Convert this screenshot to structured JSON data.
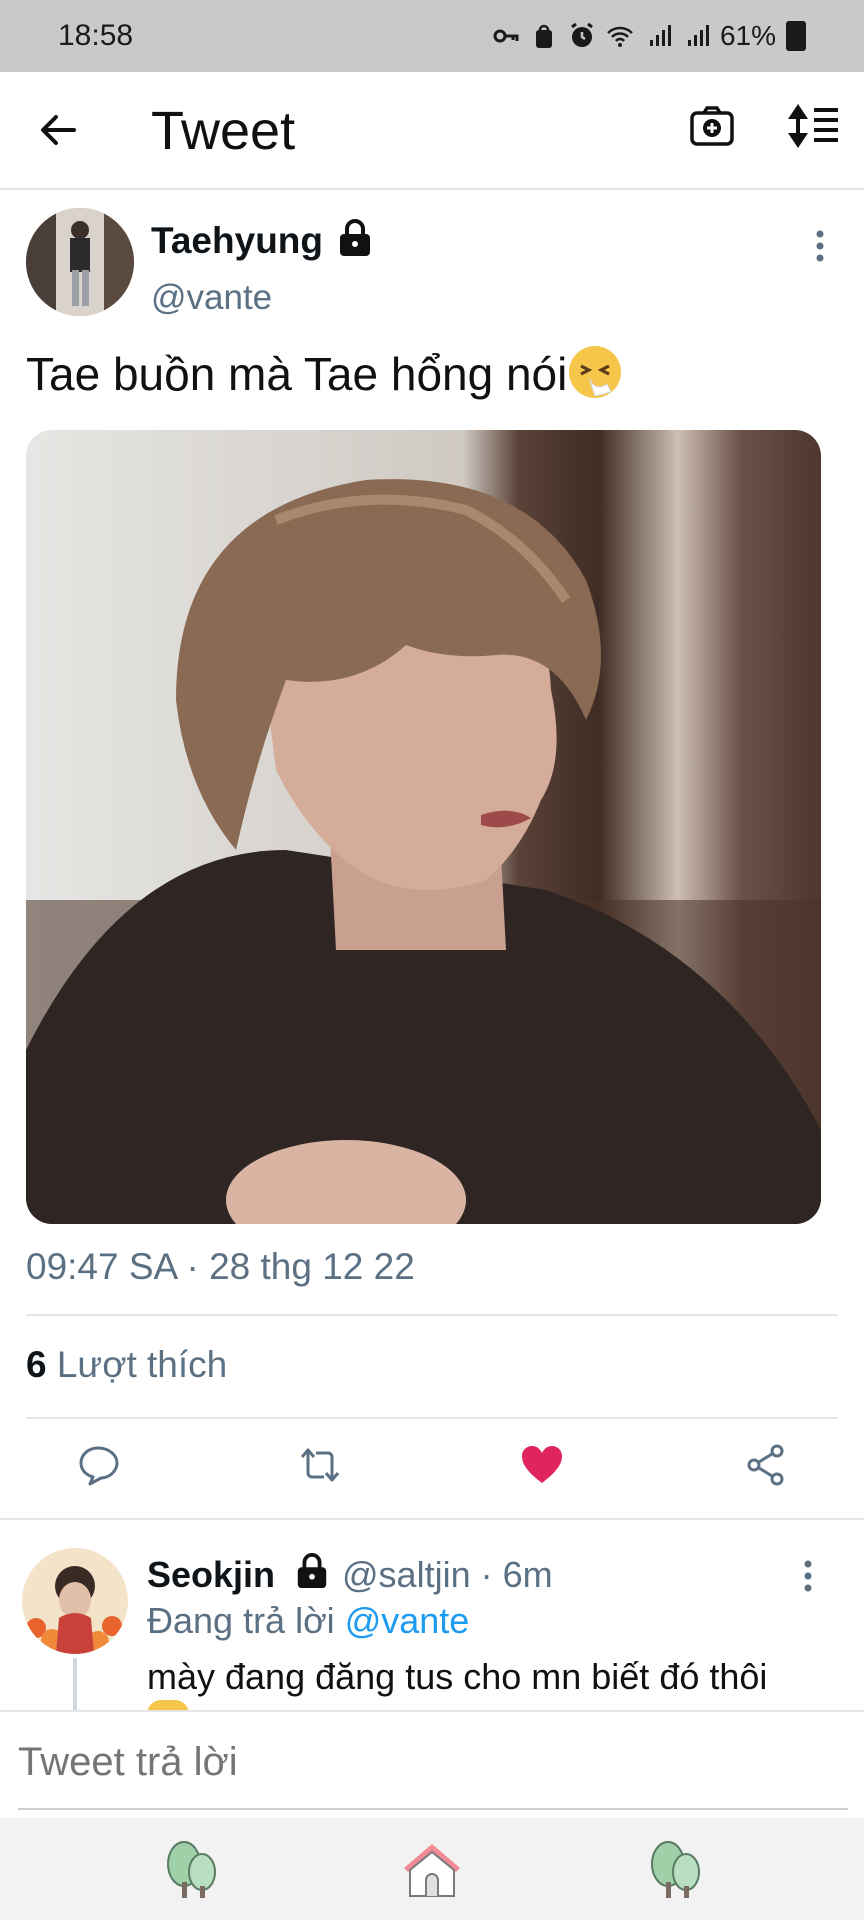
{
  "status_bar": {
    "time": "18:58",
    "battery": "61%",
    "icons": [
      "key-icon",
      "bag-icon",
      "alarm-icon",
      "wifi-icon",
      "signal-icon",
      "signal-icon",
      "battery-icon"
    ]
  },
  "header": {
    "title": "Tweet",
    "icons": [
      "back-arrow-icon",
      "camera-icon",
      "sort-icon"
    ]
  },
  "tweet": {
    "display_name": "Taehyung",
    "handle": "@vante",
    "text": "Tae buồn mà Tae hổng nói",
    "emoji": "sneezing-face",
    "timestamp": "09:47 SA · 28 thg 12 22",
    "likes_count": "6",
    "likes_label": "Lượt thích",
    "liked": true,
    "like_color": "#e0245e"
  },
  "actions": [
    "reply-icon",
    "retweet-icon",
    "like-icon",
    "share-icon"
  ],
  "reply": {
    "display_name": "Seokjin",
    "handle_time": "@saltjin · 6m",
    "replying_prefix": "Đang trả lời",
    "replying_to": "@vante",
    "text": "mày đang đăng tus cho mn biết đó thôi"
  },
  "compose": {
    "placeholder": "Tweet trả lời"
  },
  "bottom_nav": [
    "tree-icon",
    "house-icon",
    "tree-icon"
  ],
  "colors": {
    "accent": "#1d9bf0",
    "secondary_text": "#5b7083"
  }
}
